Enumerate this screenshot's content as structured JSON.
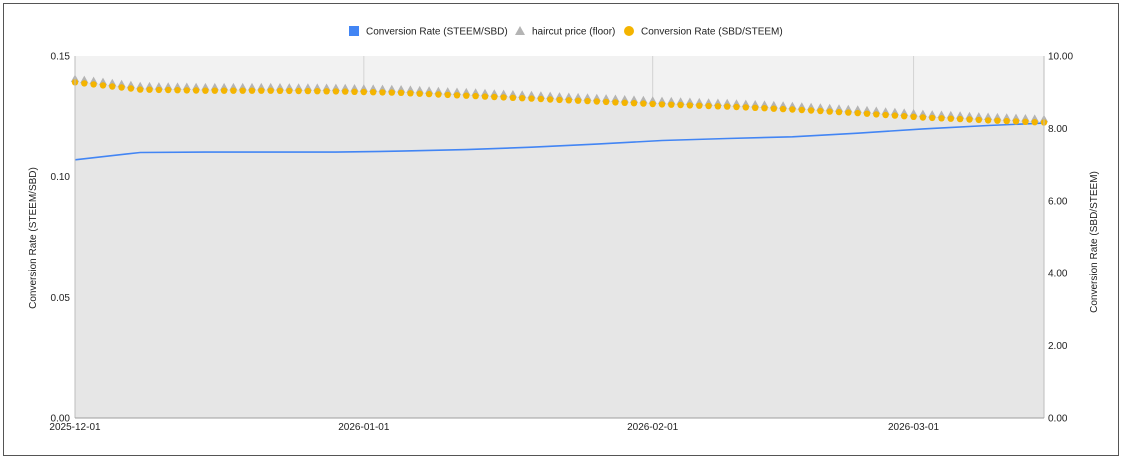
{
  "chart_data": {
    "type": "line",
    "x_ticks": [
      "2025-12-01",
      "2026-01-01",
      "2026-02-01",
      "2026-03-01"
    ],
    "x_range": [
      "2025-12-01",
      "2026-03-15"
    ],
    "y_left": {
      "label": "Conversion Rate (STEEM/SBD)",
      "ticks": [
        "0.00",
        "0.05",
        "0.10",
        "0.15"
      ],
      "range": [
        0,
        0.15
      ]
    },
    "y_right": {
      "label": "Conversion Rate (SBD/STEEM)",
      "ticks": [
        "0.00",
        "2.00",
        "4.00",
        "6.00",
        "8.00",
        "10.00"
      ],
      "range": [
        0,
        10
      ]
    },
    "grid": true,
    "legend_position": "top",
    "series": [
      {
        "name": "Conversion Rate (STEEM/SBD)",
        "axis": "left",
        "marker": "line",
        "color": "#4285f4",
        "points": [
          [
            "2025-12-01",
            0.107
          ],
          [
            "2025-12-08",
            0.11
          ],
          [
            "2025-12-15",
            0.1102
          ],
          [
            "2025-12-22",
            0.1102
          ],
          [
            "2025-12-29",
            0.1102
          ],
          [
            "2026-01-05",
            0.1106
          ],
          [
            "2026-01-12",
            0.1112
          ],
          [
            "2026-01-19",
            0.1122
          ],
          [
            "2026-01-26",
            0.1135
          ],
          [
            "2026-02-02",
            0.115
          ],
          [
            "2026-02-09",
            0.1158
          ],
          [
            "2026-02-16",
            0.1165
          ],
          [
            "2026-02-23",
            0.118
          ],
          [
            "2026-03-02",
            0.1198
          ],
          [
            "2026-03-09",
            0.1212
          ],
          [
            "2026-03-15",
            0.1222
          ]
        ]
      },
      {
        "name": "haircut price (floor)",
        "axis": "right",
        "marker": "triangle",
        "color": "#b4b4b4",
        "points": [
          [
            "2025-12-01",
            9.35
          ],
          [
            "2025-12-08",
            9.15
          ],
          [
            "2025-12-15",
            9.12
          ],
          [
            "2025-12-22",
            9.12
          ],
          [
            "2025-12-29",
            9.1
          ],
          [
            "2026-01-05",
            9.06
          ],
          [
            "2026-01-12",
            8.98
          ],
          [
            "2026-01-19",
            8.9
          ],
          [
            "2026-01-26",
            8.82
          ],
          [
            "2026-02-02",
            8.74
          ],
          [
            "2026-02-09",
            8.68
          ],
          [
            "2026-02-16",
            8.6
          ],
          [
            "2026-02-23",
            8.5
          ],
          [
            "2026-03-02",
            8.38
          ],
          [
            "2026-03-09",
            8.3
          ],
          [
            "2026-03-15",
            8.24
          ]
        ]
      },
      {
        "name": "Conversion Rate (SBD/STEEM)",
        "axis": "right",
        "marker": "circle",
        "color": "#f4b400",
        "points": [
          [
            "2025-12-01",
            9.3
          ],
          [
            "2025-12-08",
            9.1
          ],
          [
            "2025-12-15",
            9.07
          ],
          [
            "2025-12-22",
            9.07
          ],
          [
            "2025-12-29",
            9.05
          ],
          [
            "2026-01-05",
            9.01
          ],
          [
            "2026-01-12",
            8.93
          ],
          [
            "2026-01-19",
            8.85
          ],
          [
            "2026-01-26",
            8.77
          ],
          [
            "2026-02-02",
            8.69
          ],
          [
            "2026-02-09",
            8.63
          ],
          [
            "2026-02-16",
            8.55
          ],
          [
            "2026-02-23",
            8.45
          ],
          [
            "2026-03-02",
            8.33
          ],
          [
            "2026-03-09",
            8.25
          ],
          [
            "2026-03-15",
            8.19
          ]
        ]
      }
    ]
  }
}
